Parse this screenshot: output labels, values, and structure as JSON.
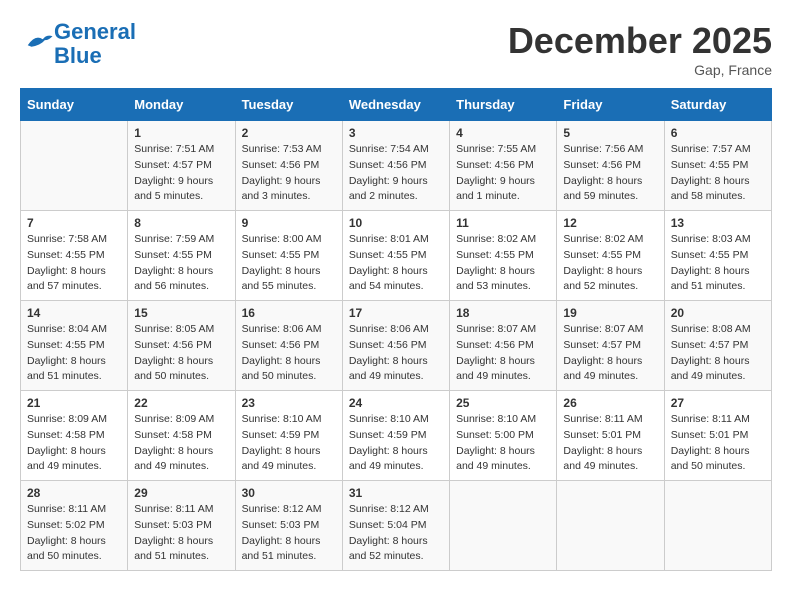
{
  "header": {
    "logo_line1": "General",
    "logo_line2": "Blue",
    "month": "December 2025",
    "location": "Gap, France"
  },
  "weekdays": [
    "Sunday",
    "Monday",
    "Tuesday",
    "Wednesday",
    "Thursday",
    "Friday",
    "Saturday"
  ],
  "weeks": [
    [
      {
        "day": "",
        "info": ""
      },
      {
        "day": "1",
        "info": "Sunrise: 7:51 AM\nSunset: 4:57 PM\nDaylight: 9 hours\nand 5 minutes."
      },
      {
        "day": "2",
        "info": "Sunrise: 7:53 AM\nSunset: 4:56 PM\nDaylight: 9 hours\nand 3 minutes."
      },
      {
        "day": "3",
        "info": "Sunrise: 7:54 AM\nSunset: 4:56 PM\nDaylight: 9 hours\nand 2 minutes."
      },
      {
        "day": "4",
        "info": "Sunrise: 7:55 AM\nSunset: 4:56 PM\nDaylight: 9 hours\nand 1 minute."
      },
      {
        "day": "5",
        "info": "Sunrise: 7:56 AM\nSunset: 4:56 PM\nDaylight: 8 hours\nand 59 minutes."
      },
      {
        "day": "6",
        "info": "Sunrise: 7:57 AM\nSunset: 4:55 PM\nDaylight: 8 hours\nand 58 minutes."
      }
    ],
    [
      {
        "day": "7",
        "info": "Sunrise: 7:58 AM\nSunset: 4:55 PM\nDaylight: 8 hours\nand 57 minutes."
      },
      {
        "day": "8",
        "info": "Sunrise: 7:59 AM\nSunset: 4:55 PM\nDaylight: 8 hours\nand 56 minutes."
      },
      {
        "day": "9",
        "info": "Sunrise: 8:00 AM\nSunset: 4:55 PM\nDaylight: 8 hours\nand 55 minutes."
      },
      {
        "day": "10",
        "info": "Sunrise: 8:01 AM\nSunset: 4:55 PM\nDaylight: 8 hours\nand 54 minutes."
      },
      {
        "day": "11",
        "info": "Sunrise: 8:02 AM\nSunset: 4:55 PM\nDaylight: 8 hours\nand 53 minutes."
      },
      {
        "day": "12",
        "info": "Sunrise: 8:02 AM\nSunset: 4:55 PM\nDaylight: 8 hours\nand 52 minutes."
      },
      {
        "day": "13",
        "info": "Sunrise: 8:03 AM\nSunset: 4:55 PM\nDaylight: 8 hours\nand 51 minutes."
      }
    ],
    [
      {
        "day": "14",
        "info": "Sunrise: 8:04 AM\nSunset: 4:55 PM\nDaylight: 8 hours\nand 51 minutes."
      },
      {
        "day": "15",
        "info": "Sunrise: 8:05 AM\nSunset: 4:56 PM\nDaylight: 8 hours\nand 50 minutes."
      },
      {
        "day": "16",
        "info": "Sunrise: 8:06 AM\nSunset: 4:56 PM\nDaylight: 8 hours\nand 50 minutes."
      },
      {
        "day": "17",
        "info": "Sunrise: 8:06 AM\nSunset: 4:56 PM\nDaylight: 8 hours\nand 49 minutes."
      },
      {
        "day": "18",
        "info": "Sunrise: 8:07 AM\nSunset: 4:56 PM\nDaylight: 8 hours\nand 49 minutes."
      },
      {
        "day": "19",
        "info": "Sunrise: 8:07 AM\nSunset: 4:57 PM\nDaylight: 8 hours\nand 49 minutes."
      },
      {
        "day": "20",
        "info": "Sunrise: 8:08 AM\nSunset: 4:57 PM\nDaylight: 8 hours\nand 49 minutes."
      }
    ],
    [
      {
        "day": "21",
        "info": "Sunrise: 8:09 AM\nSunset: 4:58 PM\nDaylight: 8 hours\nand 49 minutes."
      },
      {
        "day": "22",
        "info": "Sunrise: 8:09 AM\nSunset: 4:58 PM\nDaylight: 8 hours\nand 49 minutes."
      },
      {
        "day": "23",
        "info": "Sunrise: 8:10 AM\nSunset: 4:59 PM\nDaylight: 8 hours\nand 49 minutes."
      },
      {
        "day": "24",
        "info": "Sunrise: 8:10 AM\nSunset: 4:59 PM\nDaylight: 8 hours\nand 49 minutes."
      },
      {
        "day": "25",
        "info": "Sunrise: 8:10 AM\nSunset: 5:00 PM\nDaylight: 8 hours\nand 49 minutes."
      },
      {
        "day": "26",
        "info": "Sunrise: 8:11 AM\nSunset: 5:01 PM\nDaylight: 8 hours\nand 49 minutes."
      },
      {
        "day": "27",
        "info": "Sunrise: 8:11 AM\nSunset: 5:01 PM\nDaylight: 8 hours\nand 50 minutes."
      }
    ],
    [
      {
        "day": "28",
        "info": "Sunrise: 8:11 AM\nSunset: 5:02 PM\nDaylight: 8 hours\nand 50 minutes."
      },
      {
        "day": "29",
        "info": "Sunrise: 8:11 AM\nSunset: 5:03 PM\nDaylight: 8 hours\nand 51 minutes."
      },
      {
        "day": "30",
        "info": "Sunrise: 8:12 AM\nSunset: 5:03 PM\nDaylight: 8 hours\nand 51 minutes."
      },
      {
        "day": "31",
        "info": "Sunrise: 8:12 AM\nSunset: 5:04 PM\nDaylight: 8 hours\nand 52 minutes."
      },
      {
        "day": "",
        "info": ""
      },
      {
        "day": "",
        "info": ""
      },
      {
        "day": "",
        "info": ""
      }
    ]
  ]
}
